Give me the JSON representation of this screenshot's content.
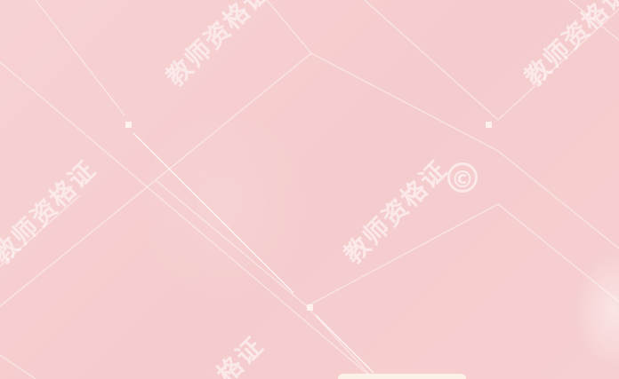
{
  "watermarks": {
    "text": "教师资格证",
    "partial_text": "格证"
  },
  "icons": {
    "copyright": "copyright-icon"
  },
  "colors": {
    "background": "#f6cfd0",
    "lines": "#ffffff",
    "tab": "#fbf1e6"
  }
}
